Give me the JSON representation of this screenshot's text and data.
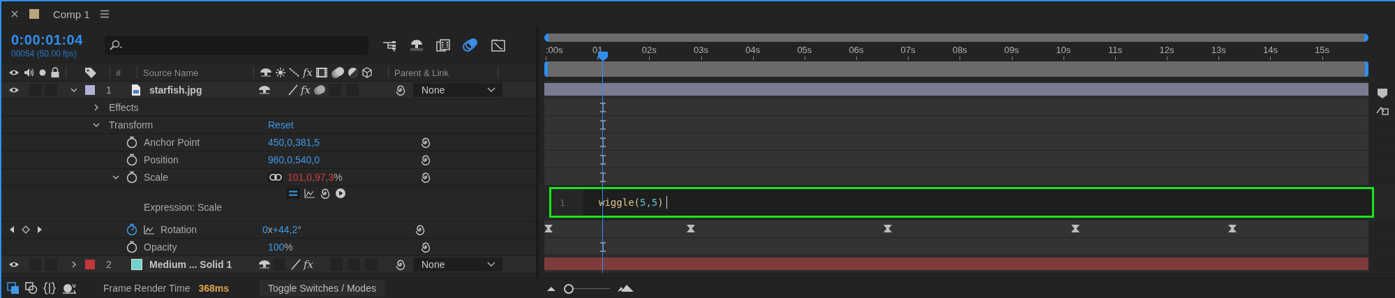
{
  "tab": {
    "title": "Comp 1",
    "label": {
      "color": "#b9a57c"
    }
  },
  "timecode": "0:00:01:04",
  "frame_info": "00054 (50.00 fps)",
  "toolbar": [
    {
      "kind": "tree",
      "on": false
    },
    {
      "kind": "shy",
      "on": false
    },
    {
      "kind": "frames",
      "on": false
    },
    {
      "kind": "blur",
      "on": true
    },
    {
      "kind": "graph",
      "on": false
    }
  ],
  "columns": {
    "number": "#",
    "source": "Source Name",
    "fx": "fx",
    "parent": "Parent & Link"
  },
  "ruler": {
    "labels": [
      ":00s",
      "01",
      "02s",
      "03s",
      "04s",
      "05s",
      "06s",
      "07s",
      "08s",
      "09s",
      "10s",
      "11s",
      "12s",
      "13s",
      "14s",
      "15s"
    ]
  },
  "playhead": {
    "level": 0.071
  },
  "layers": [
    {
      "number": "1",
      "name": "starfish.jpg",
      "source": {
        "kind": "footage"
      },
      "label": {
        "color": "#b3b1d5"
      },
      "visible": true,
      "av_switches": [
        {
          "on": false
        },
        {
          "on": false
        }
      ],
      "expanded": true,
      "parent": "None",
      "bar": {
        "color": "#7a7a91"
      },
      "switches": [
        {
          "kind": "shy"
        },
        {
          "kind": "blank"
        },
        {
          "kind": "slash"
        },
        {
          "kind": "fx",
          "text": "fx",
          "on": true
        },
        {
          "kind": "blend"
        },
        {
          "kind": "box",
          "on": false
        },
        {
          "kind": "box",
          "on": false
        }
      ],
      "properties": [
        {
          "name": "Effects",
          "kind": "group",
          "expanded": false
        },
        {
          "name": "Transform",
          "kind": "group",
          "expanded": true,
          "value": [
            {
              "text": "Reset",
              "kind": "link"
            }
          ],
          "children": [
            {
              "name": "Anchor Point",
              "kind": "property",
              "keyframed": false,
              "value": [
                {
                  "text": "450,0,381,5",
                  "kind": "number"
                }
              ]
            },
            {
              "name": "Position",
              "kind": "property",
              "keyframed": false,
              "value": [
                {
                  "text": "960,0,540,0",
                  "kind": "number"
                }
              ]
            },
            {
              "name": "Scale",
              "kind": "property",
              "keyframed": false,
              "expanded": true,
              "linked": true,
              "value": [
                {
                  "text": "101,0,97,3",
                  "kind": "number"
                },
                {
                  "text": "%",
                  "kind": "unit"
                }
              ],
              "expression": {
                "label": "Expression: Scale",
                "enabled": true,
                "lines": [
                  {
                    "number": "1",
                    "tokens": [
                      {
                        "text": "wiggle(",
                        "kind": "function"
                      },
                      {
                        "text": "5,5",
                        "kind": "number"
                      },
                      {
                        "text": ")",
                        "kind": "function"
                      }
                    ]
                  }
                ]
              }
            },
            {
              "name": "Rotation",
              "kind": "property",
              "keyframed": true,
              "value": [
                {
                  "text": "0",
                  "kind": "number"
                },
                {
                  "text": "x",
                  "kind": "unit"
                },
                {
                  "text": "+44,2",
                  "kind": "number"
                },
                {
                  "text": "°",
                  "kind": "unit"
                }
              ],
              "keyframes": [
                {
                  "level": 0.0
                },
                {
                  "level": 0.178
                },
                {
                  "level": 0.417
                },
                {
                  "level": 0.644
                },
                {
                  "level": 0.835
                }
              ]
            },
            {
              "name": "Opacity",
              "kind": "property",
              "keyframed": false,
              "value": [
                {
                  "text": "100",
                  "kind": "number"
                },
                {
                  "text": "%",
                  "kind": "unit"
                }
              ]
            }
          ]
        }
      ]
    },
    {
      "number": "2",
      "name": "Medium ... Solid 1",
      "source": {
        "kind": "solid",
        "color": "#72d2cd"
      },
      "label": {
        "color": "#c0383a"
      },
      "visible": true,
      "av_switches": [
        {
          "on": false
        },
        {
          "on": false
        }
      ],
      "expanded": false,
      "parent": "None",
      "bar": {
        "color": "#7e3b3c"
      },
      "switches": [
        {
          "kind": "shy"
        },
        {
          "kind": "box",
          "on": false
        },
        {
          "kind": "slash"
        },
        {
          "kind": "fx",
          "text": "fx",
          "on": true
        },
        {
          "kind": "blank"
        },
        {
          "kind": "box",
          "on": false
        },
        {
          "kind": "box",
          "on": false
        },
        {
          "kind": "box",
          "on": false
        }
      ]
    }
  ],
  "footer": {
    "label": "Frame Render Time",
    "value": "368ms",
    "button": "Toggle Switches / Modes",
    "zoom": {
      "level": 0.1
    }
  }
}
